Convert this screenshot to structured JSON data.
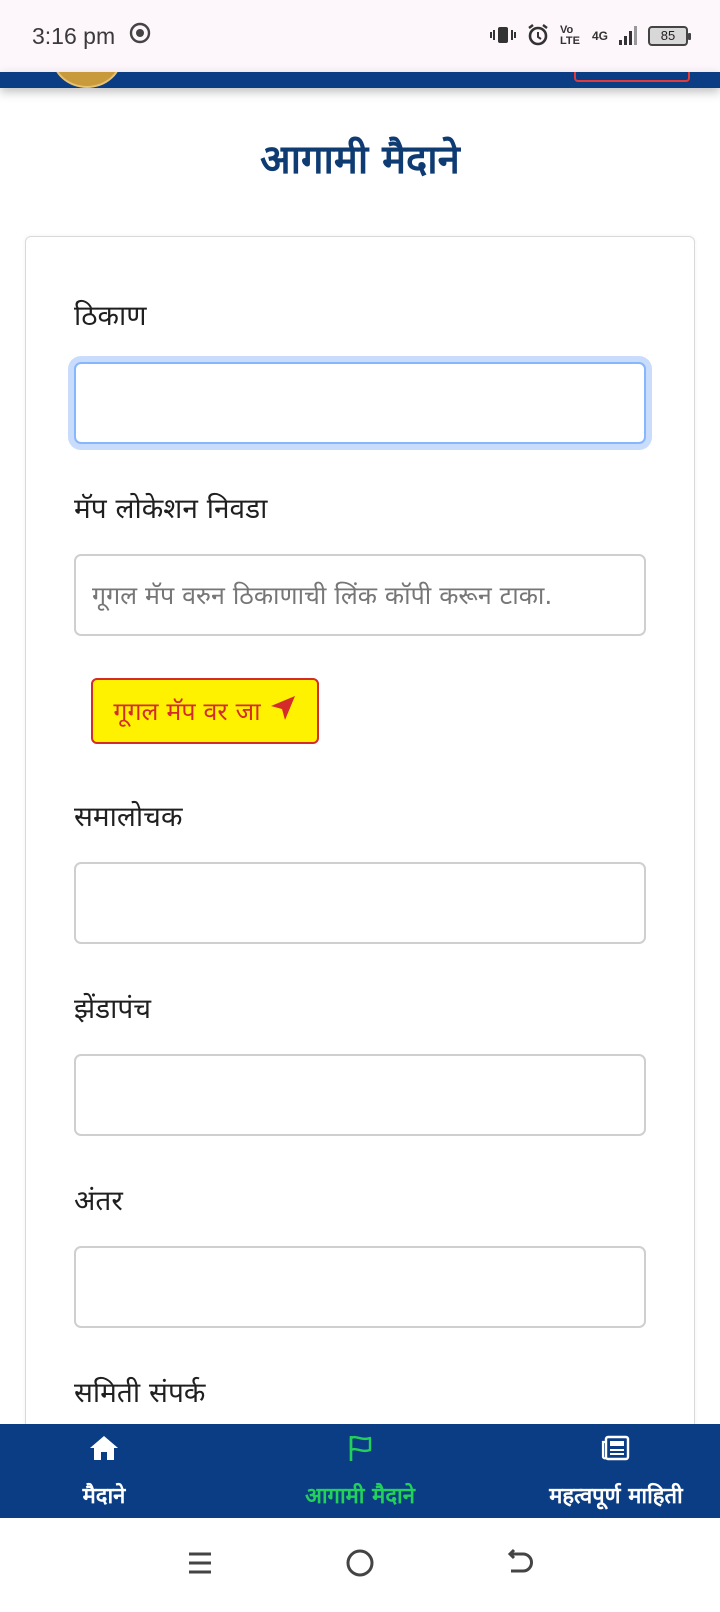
{
  "status_bar": {
    "time": "3:16 pm",
    "network": "4G",
    "volte": "Vo LTE",
    "battery": "85",
    "icons": [
      "whatsapp-icon",
      "vibrate-icon",
      "alarm-icon",
      "signal-icon",
      "battery-icon"
    ]
  },
  "page": {
    "title": "आगामी मैदाने"
  },
  "form": {
    "location_label": "ठिकाण",
    "location_value": "",
    "map_location_label": "मॅप लोकेशन निवडा",
    "map_location_placeholder": "गूगल मॅप वरुन ठिकाणाची लिंक कॉपी करून टाका.",
    "map_button_label": "गूगल मॅप वर जा",
    "commentator_label": "समालोचक",
    "flag_umpire_label": "झेंडापंच",
    "distance_label": "अंतर",
    "committee_contact_label": "समिती संपर्क"
  },
  "bottom_nav": {
    "items": [
      {
        "label": "मैदाने",
        "icon": "home-icon",
        "active": false
      },
      {
        "label": "आगामी मैदाने",
        "icon": "flag-icon",
        "active": true
      },
      {
        "label": "महत्वपूर्ण माहिती",
        "icon": "newspaper-icon",
        "active": false
      }
    ]
  },
  "colors": {
    "primary": "#0b3d84",
    "title": "#0f3b73",
    "active_nav": "#22d05a",
    "button_bg": "#fff200",
    "button_accent": "#d42b2b",
    "focus_ring": "#86b7fe"
  }
}
